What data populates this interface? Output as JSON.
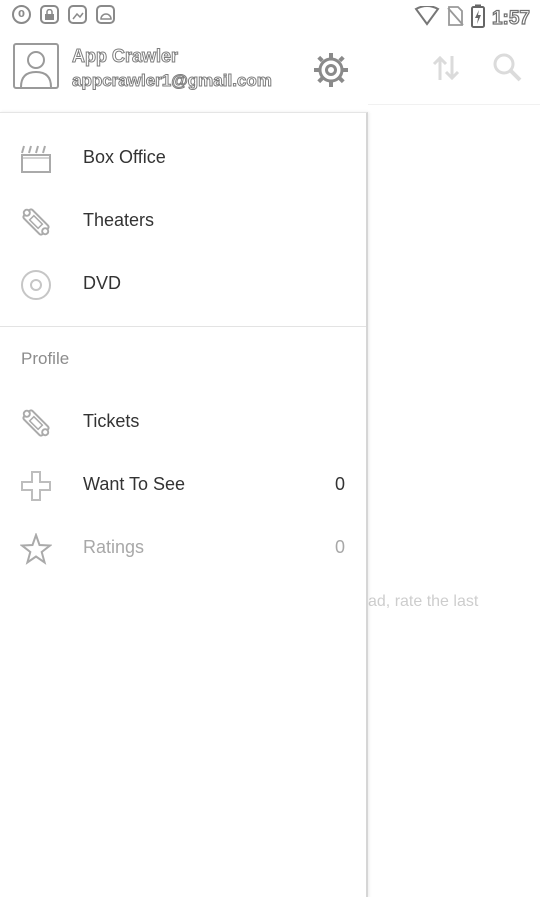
{
  "status_bar": {
    "time": "1:57",
    "left_icons": [
      "sync-icon",
      "lock-icon",
      "photo-icon",
      "android-icon"
    ],
    "right_icons": [
      "wifi-icon",
      "no-sim-icon",
      "battery-charging-icon"
    ]
  },
  "drawer": {
    "header": {
      "name": "App Crawler",
      "email": "appcrawler1@gmail.com"
    },
    "main_items": [
      {
        "label": "Box Office",
        "icon": "clapperboard-icon"
      },
      {
        "label": "Theaters",
        "icon": "ticket-icon"
      },
      {
        "label": "DVD",
        "icon": "disc-icon"
      }
    ],
    "profile_section": {
      "title": "Profile",
      "items": [
        {
          "label": "Tickets",
          "icon": "ticket-icon",
          "count": ""
        },
        {
          "label": "Want To See",
          "icon": "plus-icon",
          "count": "0"
        },
        {
          "label": "Ratings",
          "icon": "star-icon",
          "count": "0"
        }
      ]
    }
  },
  "background_screen": {
    "partial_text": "ad, rate the last",
    "toolbar_icons": [
      "sort-icon",
      "search-icon"
    ]
  }
}
